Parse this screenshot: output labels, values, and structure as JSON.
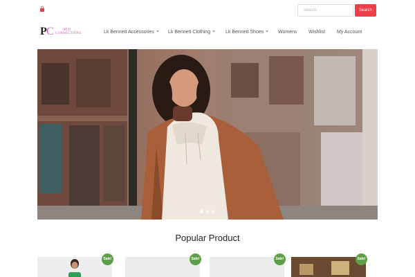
{
  "topbar": {
    "cart_icon": "shopping-bag-icon",
    "search_placeholder": "Search",
    "search_button": "Search",
    "accent": "#ec3f4a"
  },
  "logo": {
    "letter1": "P",
    "letter2": "C",
    "line1": "RTD",
    "line2": "CONNECTIONS"
  },
  "nav": {
    "items": [
      {
        "label": "Lk Bennett Accessories",
        "dropdown": true
      },
      {
        "label": "Lk Bennett Clothing",
        "dropdown": true
      },
      {
        "label": "Lk Bennett Shoes",
        "dropdown": true
      },
      {
        "label": "Womens",
        "dropdown": false
      },
      {
        "label": "Wishlist",
        "dropdown": false
      },
      {
        "label": "My Account",
        "dropdown": false
      }
    ]
  },
  "hero": {
    "slides": 3,
    "active_slide": 1
  },
  "popular": {
    "title": "Popular Product",
    "badge": "Sale!",
    "badge_color": "#5d9f48"
  }
}
